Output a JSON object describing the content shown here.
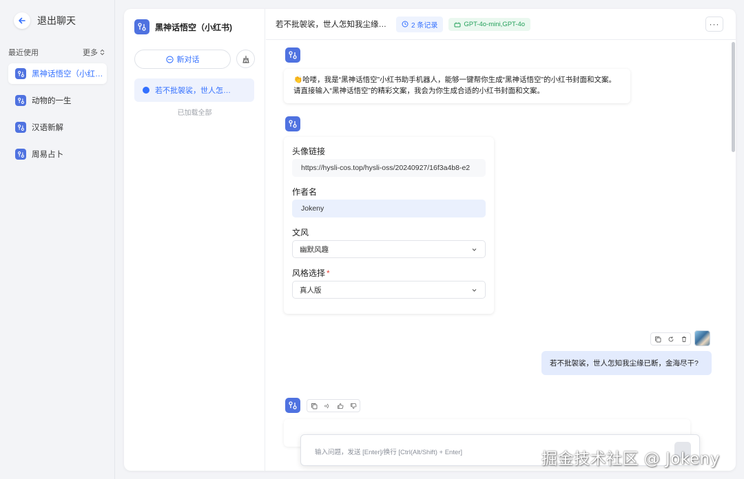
{
  "sidebar": {
    "exit_label": "退出聊天",
    "recent_label": "最近使用",
    "more_label": "更多",
    "items": [
      {
        "label": "黑神话悟空（小红…"
      },
      {
        "label": "动物的一生"
      },
      {
        "label": "汉语新解"
      },
      {
        "label": "周易占卜"
      }
    ]
  },
  "app": {
    "title": "黑神话悟空（小红书)",
    "new_chat_label": "新对话",
    "history": [
      {
        "label": "若不批袈裟，世人怎…"
      }
    ],
    "loaded_all": "已加载全部"
  },
  "chat": {
    "title": "若不批袈裟，世人怎知我尘缘…",
    "records_tag": "2 条记录",
    "models_tag": "GPT-4o-mini,GPT-4o",
    "more_label": "···",
    "bot_greeting_line1": "👏哈喽，我是“黑神话悟空”小红书助手机器人，能够一键帮你生成“黑神话悟空”的小红书封面和文案。",
    "bot_greeting_line2": "请直接输入“黑神话悟空”的精彩文案，我会为你生成合适的小红书封面和文案。",
    "form": {
      "avatar_label": "头像链接",
      "avatar_value": "https://hysli-cos.top/hysli-oss/20240927/16f3a4b8-e2",
      "author_label": "作者名",
      "author_value": "Jokeny",
      "style_label": "文风",
      "style_value": "幽默风趣",
      "look_label": "风格选择",
      "look_value": "真人版"
    },
    "user_message": "若不批袈裟，世人怎知我尘缘已断，金海尽干?",
    "input_placeholder": "输入问题，发送 [Enter]/换行 [Ctrl(Alt/Shift) + Enter]"
  },
  "watermark": "掘金技术社区 @ Jokeny",
  "colors": {
    "accent": "#3370ff",
    "bot_icon": "#4f72e0",
    "user_bubble": "#e3ebfd",
    "model_tag": "#23a05a"
  }
}
